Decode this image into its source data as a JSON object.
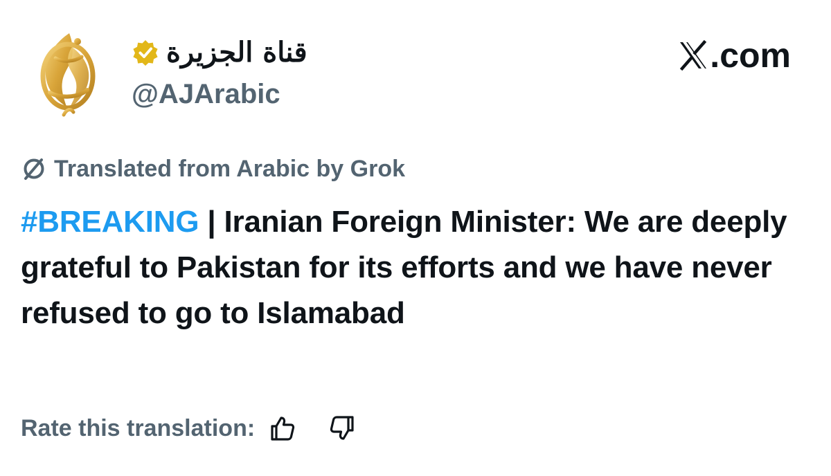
{
  "header": {
    "display_name": "قناة الجزيرة",
    "handle": "@AJArabic",
    "site_label": "X.com",
    "avatar_icon": "al-jazeera-logo",
    "verified_icon": "verified-badge-icon",
    "verified_color": "#e2b719"
  },
  "translation": {
    "label": "Translated from Arabic by Grok",
    "icon": "grok-icon"
  },
  "tweet": {
    "hashtag": "#BREAKING",
    "text": " | Iranian Foreign Minister: We are deeply grateful to Pakistan for its efforts and we have never refused to go to Islamabad",
    "hashtag_color": "#1d9bf0"
  },
  "rating": {
    "label": "Rate this translation:",
    "up_icon": "thumbs-up-icon",
    "down_icon": "thumbs-down-icon"
  }
}
